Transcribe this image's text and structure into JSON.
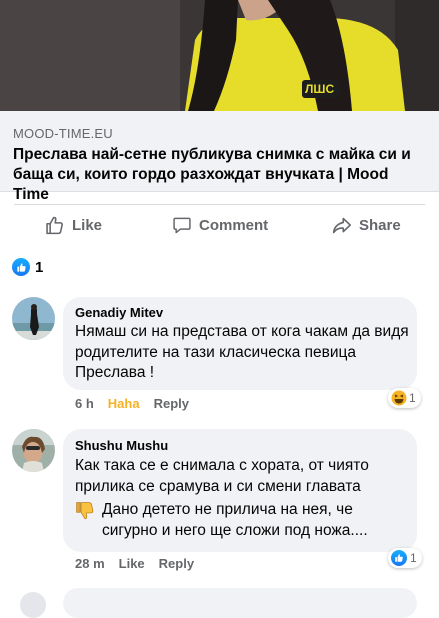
{
  "link_preview": {
    "domain": "MOOD-TIME.EU",
    "headline": "Преслава най-сетне публикува снимка с майка си и баща си, които гордо разхождат внучката | Mood Time",
    "shirt_logo": "ЛШС"
  },
  "actions": {
    "like": "Like",
    "comment": "Comment",
    "share": "Share"
  },
  "post_reactions": {
    "count": "1"
  },
  "comments": [
    {
      "author": "Genadiy Mitev",
      "text": "Нямаш си на представа от кога чакам да видя  родителите на тази класическа певица Преслава !",
      "time": "6 h",
      "reacted_label": "Haha",
      "reply_label": "Reply",
      "reaction_count": "1"
    },
    {
      "author": "Shushu Mushu",
      "text_line1": "Как така се е снимала с хората, от чиято прилика се срамува и си смени главата",
      "text_line2": "Дано детето не прилича на нея, че сигурно и него ще сложи под ножа....",
      "time": "28 m",
      "like_label": "Like",
      "reply_label": "Reply",
      "reaction_count": "1"
    }
  ],
  "colors": {
    "secondary_text": "#65676b",
    "bubble": "#f0f2f5",
    "haha": "#f7b125",
    "facebook_blue": "#1877f2"
  }
}
